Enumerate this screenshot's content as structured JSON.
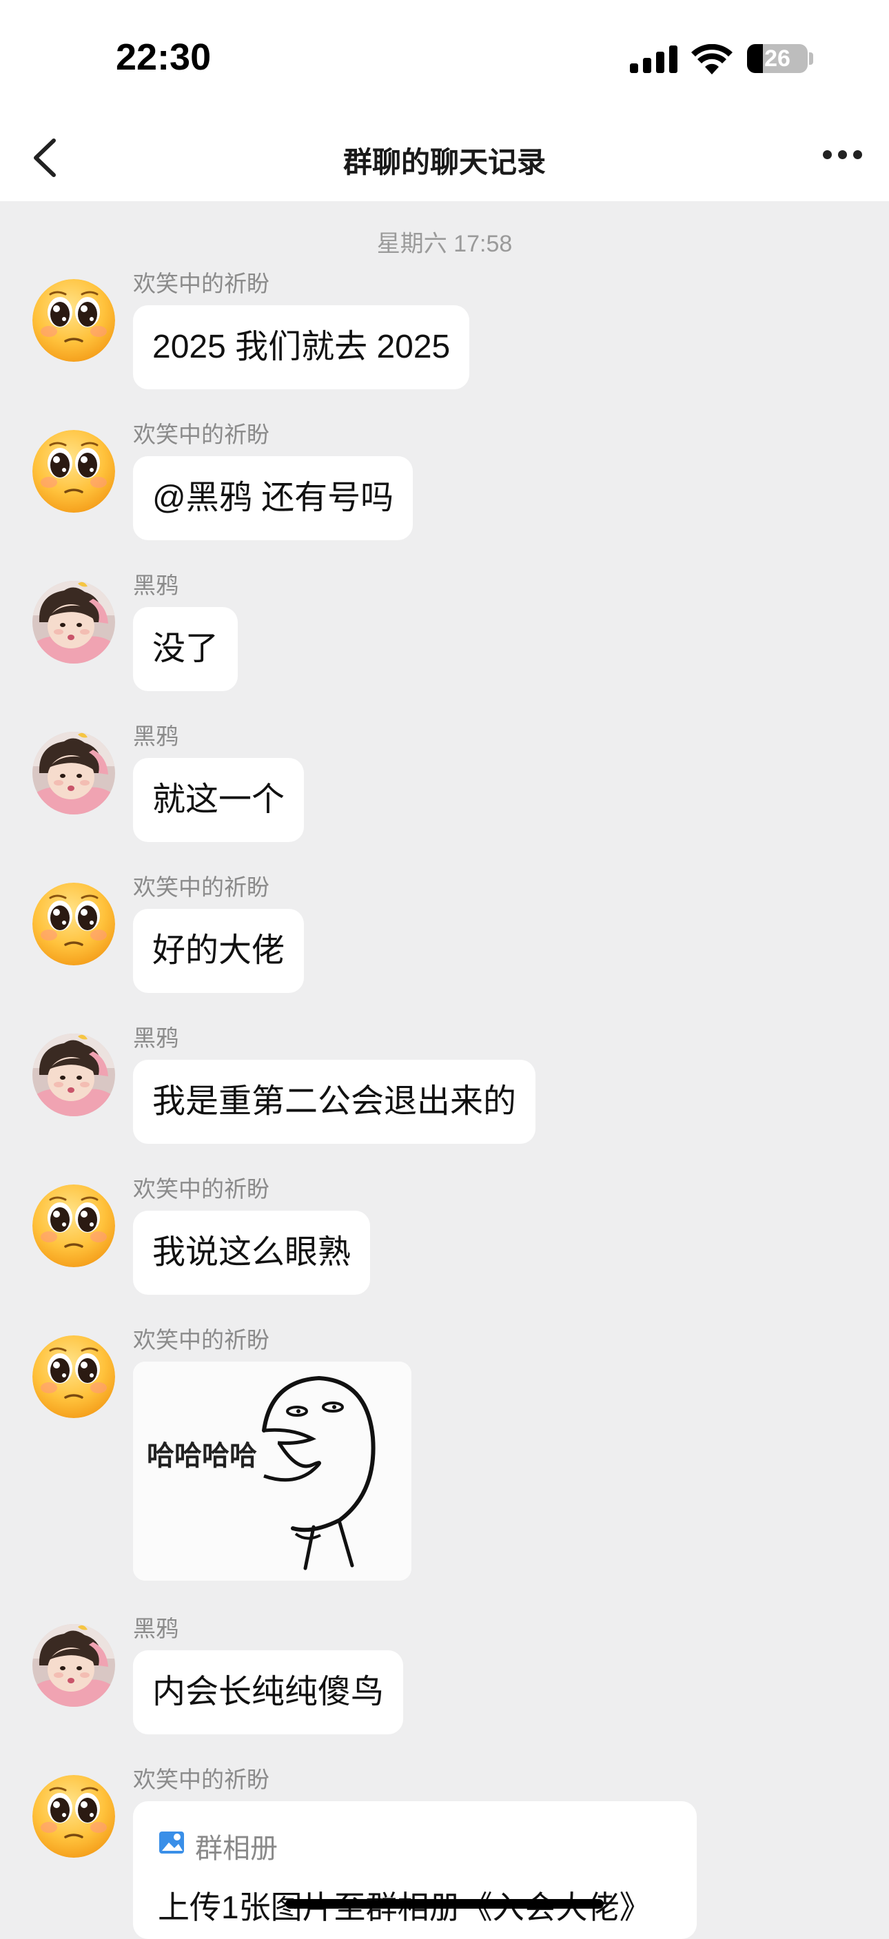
{
  "status_bar": {
    "time": "22:30",
    "battery": "26",
    "battery_fraction": 0.26
  },
  "nav": {
    "title": "群聊的聊天记录",
    "back_icon": "chevron-left-icon",
    "more_icon": "more-dots-icon"
  },
  "timestamp": "星期六 17:58",
  "participants": {
    "a": {
      "name": "欢笑中的祈盼",
      "avatar": "emoji-pleading-face"
    },
    "b": {
      "name": "黑鸦",
      "avatar": "child-photo"
    }
  },
  "messages": [
    {
      "sender": "欢笑中的祈盼",
      "type": "text",
      "text": "2025 我们就去 2025"
    },
    {
      "sender": "欢笑中的祈盼",
      "type": "text",
      "text": "@黑鸦 还有号吗"
    },
    {
      "sender": "黑鸦",
      "type": "text",
      "text": "没了"
    },
    {
      "sender": "黑鸦",
      "type": "text",
      "text": "就这一个"
    },
    {
      "sender": "欢笑中的祈盼",
      "type": "text",
      "text": "好的大佬"
    },
    {
      "sender": "黑鸦",
      "type": "text",
      "text": "我是重第二公会退出来的"
    },
    {
      "sender": "欢笑中的祈盼",
      "type": "text",
      "text": "我说这么眼熟"
    },
    {
      "sender": "欢笑中的祈盼",
      "type": "image",
      "caption": "哈哈哈哈"
    },
    {
      "sender": "黑鸦",
      "type": "text",
      "text": "内会长纯纯傻鸟"
    },
    {
      "sender": "欢笑中的祈盼",
      "type": "card",
      "label": "群相册",
      "text": "上传1张图片至群相册《入会大佬》"
    }
  ]
}
